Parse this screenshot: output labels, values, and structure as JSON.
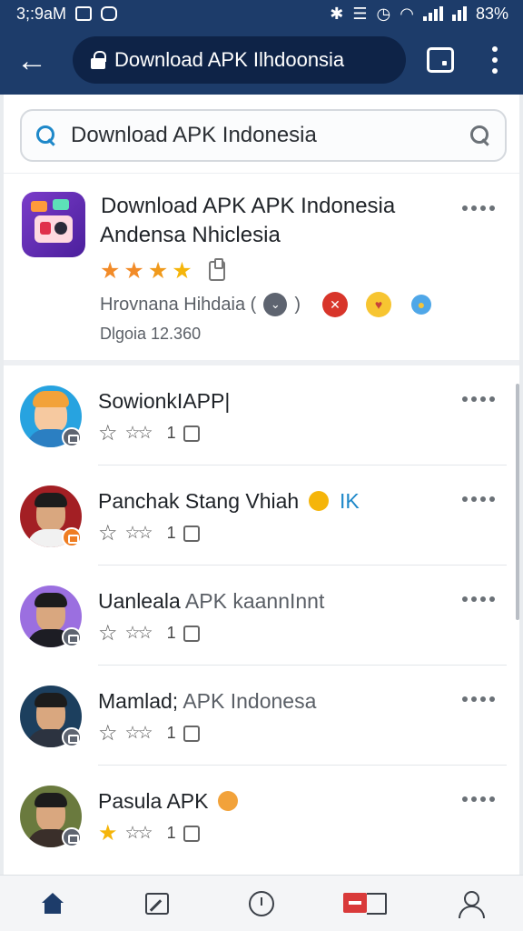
{
  "status_bar": {
    "time": "3;:9aM",
    "battery": "83%"
  },
  "browser": {
    "url": "Download APK Ilhdoonsia",
    "icons": {
      "back": "arrow-left",
      "lock": "lock",
      "tabs": "tab-switcher",
      "menu": "kebab-menu"
    }
  },
  "search": {
    "query": "Download APK Indonesia"
  },
  "featured": {
    "title_line1": "Download APK APK Indonesia",
    "title_line2": "Andensa Nhiclesia",
    "rating_stars": 4,
    "developer": "Hrovnana Hihdaia (",
    "developer_close": ")",
    "count": "Dlgoia 12.360"
  },
  "items": [
    {
      "title": "SowionkIAPP|",
      "title_muted": "",
      "rating_left": "☆",
      "rating_mid": "☆☆",
      "count": "1",
      "badge": "gray"
    },
    {
      "title": "Panchak Stang Vhiah",
      "title_muted": "",
      "tag": "IK",
      "rating_left": "☆",
      "rating_mid": "☆☆",
      "count": "1",
      "badge": "orange"
    },
    {
      "title": "Uanleala",
      "title_muted": "APK kaannInnt",
      "rating_left": "☆",
      "rating_mid": "☆☆",
      "count": "1",
      "badge": "gray"
    },
    {
      "title": "Mamlad;",
      "title_muted": "APK Indonesa",
      "rating_left": "☆",
      "rating_mid": "☆☆",
      "count": "1",
      "badge": "gray"
    },
    {
      "title": "Pasula APK",
      "title_muted": "",
      "rating_left": "★",
      "rating_mid": "☆☆",
      "count": "1",
      "badge": "gray"
    }
  ],
  "colors": {
    "appbar": "#1d3c6a",
    "star_gold": "#f5b50a",
    "accent_blue": "#1e88c9"
  }
}
